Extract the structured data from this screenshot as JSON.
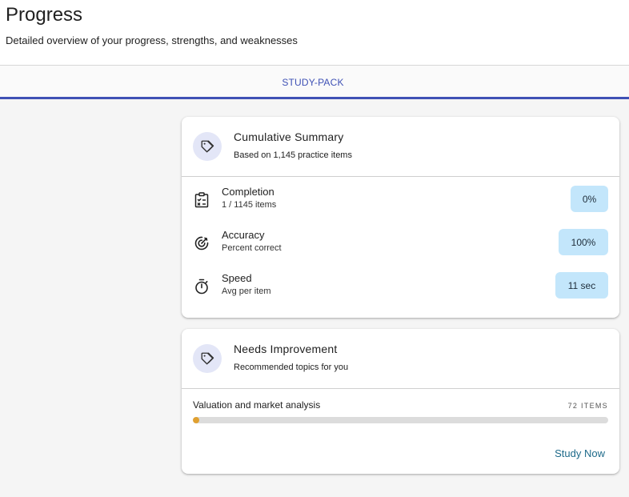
{
  "header": {
    "title": "Progress",
    "subtitle": "Detailed overview of your progress, strengths, and weaknesses"
  },
  "tabs": [
    {
      "label": "STUDY-PACK",
      "selected": true
    }
  ],
  "summary_card": {
    "icon": "tag-icon",
    "title": "Cumulative Summary",
    "subtitle": "Based on 1,145 practice items",
    "stats": [
      {
        "icon": "clipboard-checklist-icon",
        "label": "Completion",
        "sub": "1 / 1145 items",
        "value": "0%"
      },
      {
        "icon": "target-icon",
        "label": "Accuracy",
        "sub": "Percent correct",
        "value": "100%"
      },
      {
        "icon": "stopwatch-icon",
        "label": "Speed",
        "sub": "Avg per item",
        "value": "11 sec"
      }
    ]
  },
  "needs_card": {
    "icon": "tag-icon",
    "title": "Needs Improvement",
    "subtitle": "Recommended topics for you",
    "topics": [
      {
        "name": "Valuation and market analysis",
        "count": "72 ITEMS",
        "progress_fraction": 0.015
      }
    ],
    "action_label": "Study Now"
  },
  "colors": {
    "accent": "#3f51b5",
    "chip": "#c3e6fb",
    "progress_fill": "#e0a030",
    "link": "#1e6a8a",
    "icon_circle": "#e3e6f7"
  }
}
